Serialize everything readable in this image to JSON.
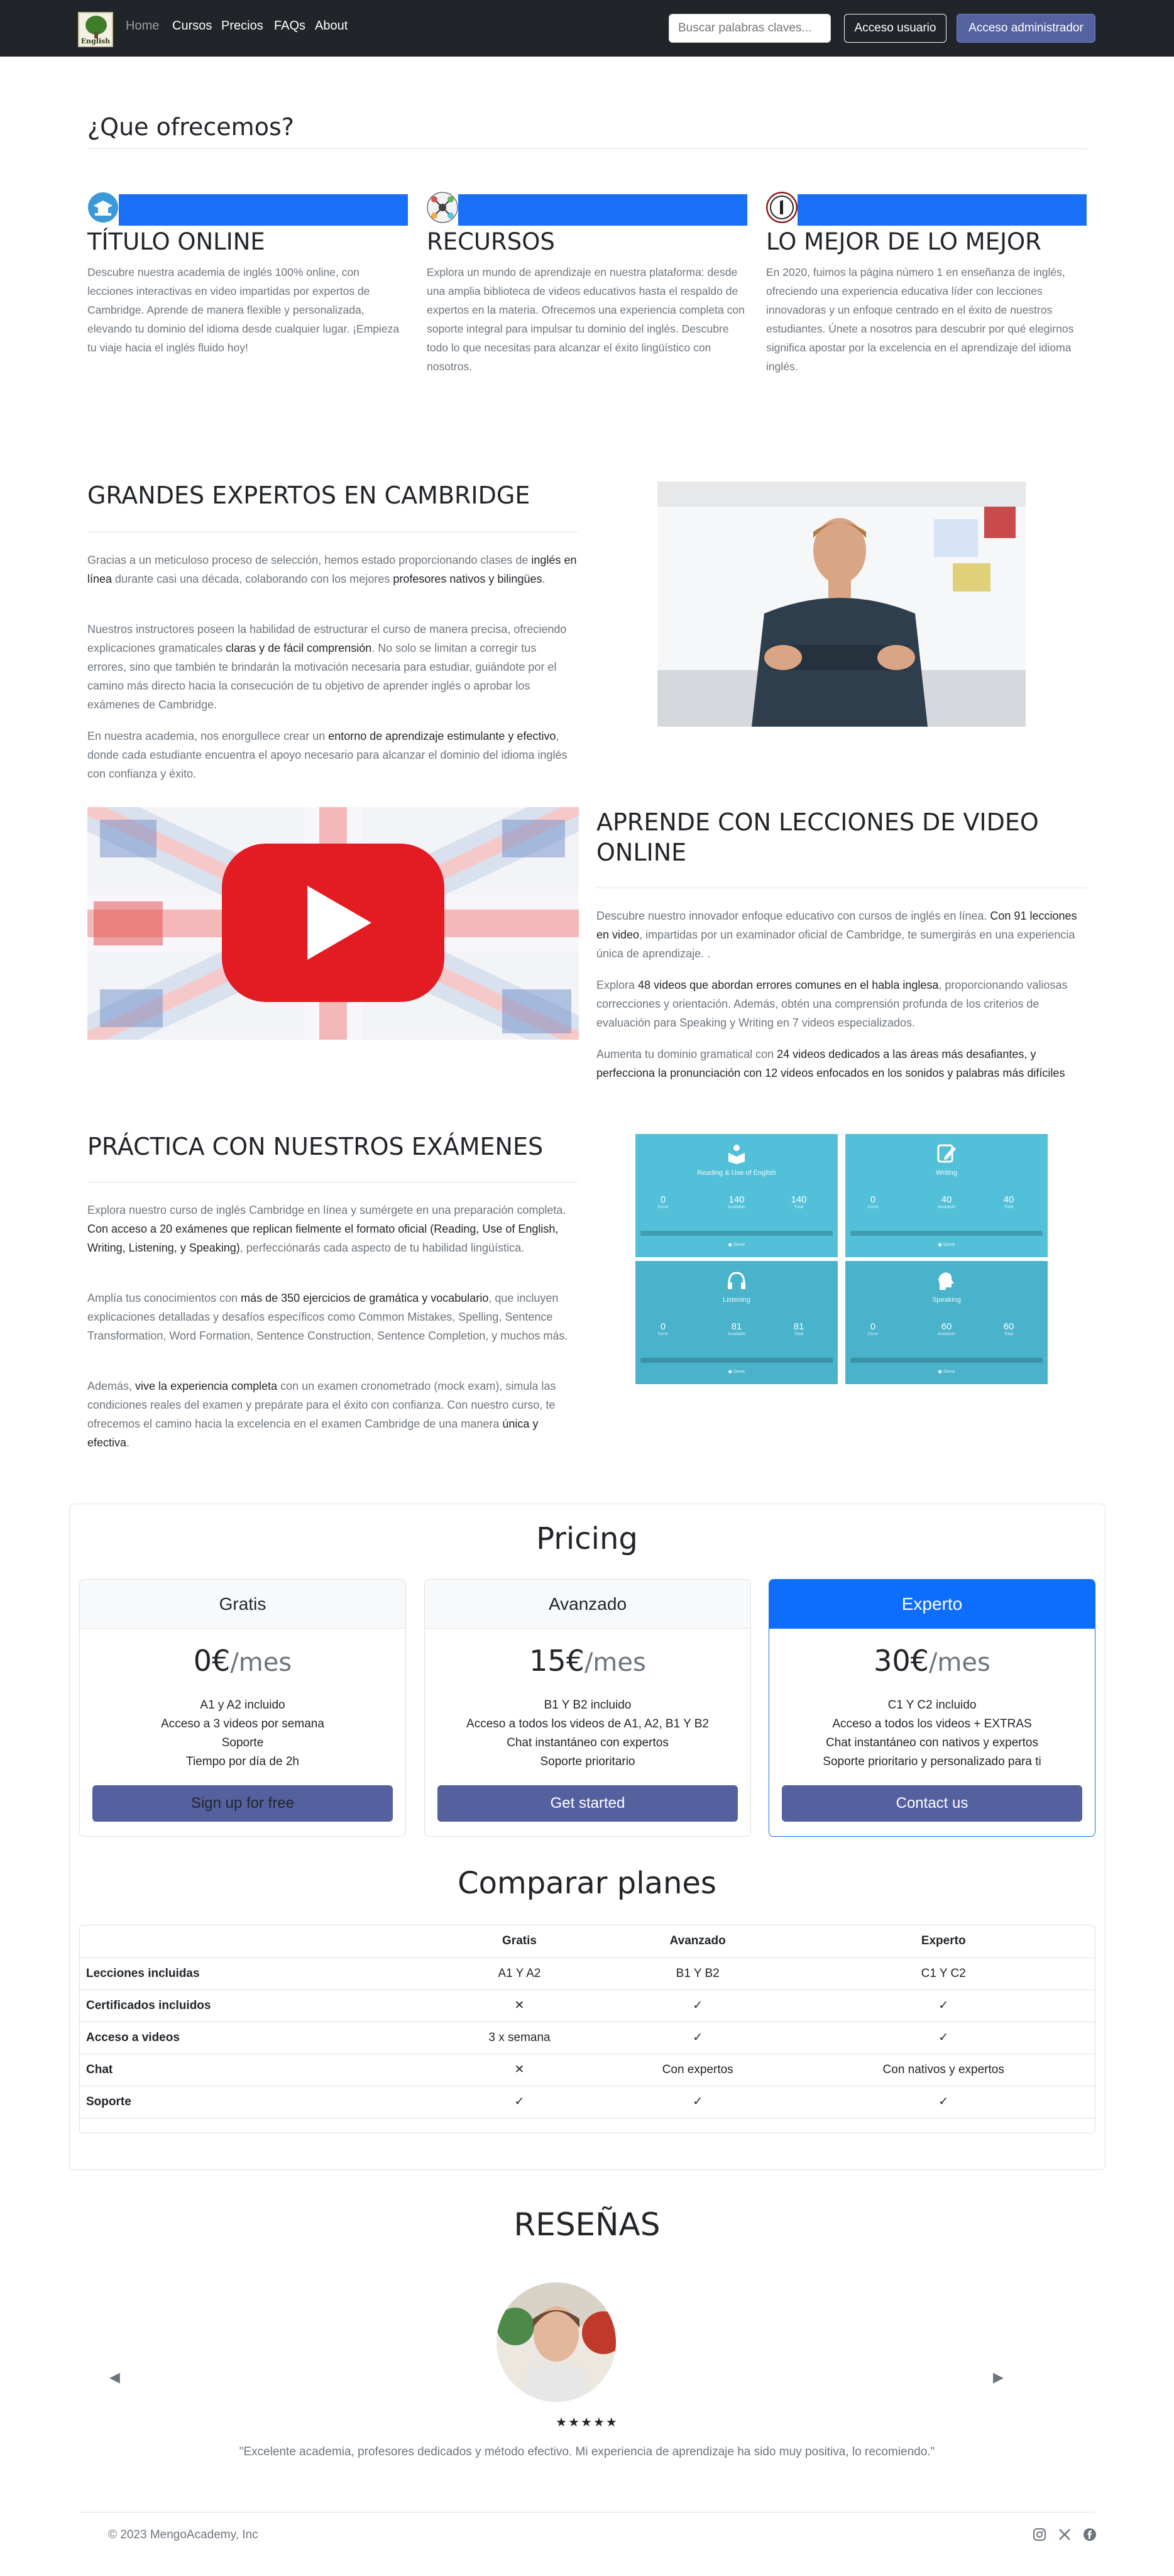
{
  "nav": {
    "logo_text": "English",
    "links": [
      "Home",
      "Cursos",
      "Precios",
      "FAQs",
      "About"
    ],
    "search_placeholder": "Buscar palabras claves...",
    "login_label": "Acceso usuario",
    "admin_label": "Acceso administrador"
  },
  "offer": {
    "title": "¿Que ofrecemos?",
    "features": [
      {
        "icon": "graduation-icon",
        "title": "TÍTULO ONLINE",
        "text": "Descubre nuestra academia de inglés 100% online, con lecciones interactivas en video impartidas por expertos de Cambridge. Aprende de manera flexible y personalizada, elevando tu dominio del idioma desde cualquier lugar. ¡Empieza tu viaje hacia el inglés fluido hoy!"
      },
      {
        "icon": "network-icon",
        "title": "RECURSOS",
        "text": "Explora un mundo de aprendizaje en nuestra plataforma: desde una amplia biblioteca de videos educativos hasta el respaldo de expertos en la materia. Ofrecemos una experiencia completa con soporte integral para impulsar tu dominio del inglés. Descubre todo lo que necesitas para alcanzar el éxito lingüístico con nosotros."
      },
      {
        "icon": "number-one-icon",
        "title": "LO MEJOR DE LO MEJOR",
        "text": "En 2020, fuimos la página número 1 en enseñanza de inglés, ofreciendo una experiencia educativa líder con lecciones innovadoras y un enfoque centrado en el éxito de nuestros estudiantes. Únete a nosotros para descubrir por qué elegirnos significa apostar por la excelencia en el aprendizaje del idioma inglés."
      }
    ]
  },
  "experts": {
    "title": "GRANDES EXPERTOS EN CAMBRIDGE",
    "p1_a": "Gracias a un meticuloso proceso de selección, hemos estado proporcionando clases de ",
    "p1_b": "inglés en línea",
    "p1_c": " durante casi una década, colaborando con los mejores ",
    "p1_d": "profesores nativos y bilingües",
    "p1_e": ".",
    "p2_a": "Nuestros instructores poseen la habilidad de estructurar el curso de manera precisa, ofreciendo explicaciones gramaticales ",
    "p2_b": "claras y de fácil comprensión",
    "p2_c": ". No solo se limitan a corregir tus errores, sino que también te brindarán la motivación necesaria para estudiar, guiándote por el camino más directo hacia la consecución de tu objetivo de aprender inglés o aprobar los exámenes de Cambridge.",
    "p3_a": "En nuestra academia, nos enorgullece crear un ",
    "p3_b": "entorno de aprendizaje estimulante y efectivo",
    "p3_c": ", donde cada estudiante encuentra el apoyo necesario para alcanzar el dominio del idioma inglés con confianza y éxito."
  },
  "video": {
    "title": "APRENDE CON LECCIONES DE VIDEO ONLINE",
    "p1_a": "Descubre nuestro innovador enfoque educativo con cursos de inglés en línea. ",
    "p1_b": "Con 91 lecciones en video",
    "p1_c": ", impartidas por un examinador oficial de Cambridge, te sumergirás en una experiencia única de aprendizaje. .",
    "p2_a": "Explora ",
    "p2_b": "48 videos que abordan errores comunes en el habla inglesa",
    "p2_c": ", proporcionando valiosas correcciones y orientación. Además, obtén una comprensión profunda de los criterios de evaluación para Speaking y Writing en 7 videos especializados.",
    "p3_a": "Aumenta tu dominio gramatical con ",
    "p3_b": "24 videos dedicados a las áreas más desafiantes, y perfecciona la pronunciación con 12 videos enfocados en los sonidos y palabras más difíciles"
  },
  "exams": {
    "title": "PRÁCTICA CON NUESTROS EXÁMENES",
    "p1_a": "Explora nuestro curso de inglés Cambridge en línea y sumérgete en una preparación completa. ",
    "p1_b": "Con acceso a 20 exámenes que replican fielmente el formato oficial (Reading, Use of English, Writing, Listening, y Speaking)",
    "p1_c": ", perfecciónarás cada aspecto de tu habilidad lingüística.",
    "p2_a": "Amplía tus conocimientos con ",
    "p2_b": "más de 350 ejercicios de gramática y vocabulario",
    "p2_c": ", que incluyen explicaciones detalladas y desafíos específicos como Common Mistakes, Spelling, Sentence Transformation, Word Formation, Sentence Construction, Sentence Completion, y muchos más.",
    "p3_a": "Además, ",
    "p3_b": "vive la experiencia completa",
    "p3_c": " con un examen cronometrado (mock exam), simula las condiciones reales del examen y prepárate para el éxito con confianza. Con nuestro curso, te ofrecemos el camino hacia la excelencia en el examen Cambridge de una manera ",
    "p3_d": "única y efectiva",
    "p3_e": ".",
    "cards": [
      {
        "name": "Reading & Use of English",
        "icon": "reader-icon",
        "stats": [
          "0",
          "140",
          "140"
        ],
        "labels": [
          "Done",
          "Available",
          "Total"
        ]
      },
      {
        "name": "Writing",
        "icon": "pencil-icon",
        "stats": [
          "0",
          "40",
          "40"
        ],
        "labels": [
          "Done",
          "Available",
          "Total"
        ]
      },
      {
        "name": "Listening",
        "icon": "headphones-icon",
        "stats": [
          "0",
          "81",
          "81"
        ],
        "labels": [
          "Done",
          "Available",
          "Total"
        ]
      },
      {
        "name": "Speaking",
        "icon": "speaking-head-icon",
        "stats": [
          "0",
          "60",
          "60"
        ],
        "labels": [
          "Done",
          "Available",
          "Total"
        ]
      }
    ]
  },
  "pricing": {
    "title": "Pricing",
    "plans": [
      {
        "name": "Gratis",
        "price": "0€",
        "per": "/mes",
        "features": [
          "A1 y A2 incluido",
          "Acceso a 3 videos por semana",
          "Soporte",
          "Tiempo por día de 2h"
        ],
        "cta": "Sign up for free"
      },
      {
        "name": "Avanzado",
        "price": "15€",
        "per": "/mes",
        "features": [
          "B1 Y B2 incluido",
          "Acceso a todos los videos de A1, A2, B1 Y B2",
          "Chat instantáneo con expertos",
          "Soporte prioritario"
        ],
        "cta": "Get started"
      },
      {
        "name": "Experto",
        "price": "30€",
        "per": "/mes",
        "features": [
          "C1 Y C2 incluido",
          "Acceso a todos los videos + EXTRAS",
          "Chat instantáneo con nativos y expertos",
          "Soporte prioritario y personalizado para ti"
        ],
        "cta": "Contact us"
      }
    ]
  },
  "compare": {
    "title": "Comparar planes",
    "headers": [
      "",
      "Gratis",
      "Avanzado",
      "Experto"
    ],
    "rows": [
      {
        "label": "Lecciones incluidas",
        "cells": [
          "A1 Y A2",
          "B1 Y B2",
          "C1 Y C2"
        ]
      },
      {
        "label": "Certificados incluidos",
        "cells": [
          "✕",
          "✓",
          "✓"
        ]
      },
      {
        "label": "Acceso a videos",
        "cells": [
          "3 x semana",
          "✓",
          "✓"
        ]
      },
      {
        "label": "Chat",
        "cells": [
          "✕",
          "Con expertos",
          "Con nativos y expertos"
        ]
      },
      {
        "label": "Soporte",
        "cells": [
          "✓",
          "✓",
          "✓"
        ]
      }
    ]
  },
  "reviews": {
    "title": "RESEÑAS",
    "stars": "★★★★★",
    "quote": "\"Excelente academia, profesores dedicados y método efectivo. Mi experiencia de aprendizaje ha sido muy positiva, lo recomiendo.\"",
    "prev": "◀",
    "next": "▶"
  },
  "footer": {
    "copyright": "© 2023 MengoAcademy, Inc"
  }
}
